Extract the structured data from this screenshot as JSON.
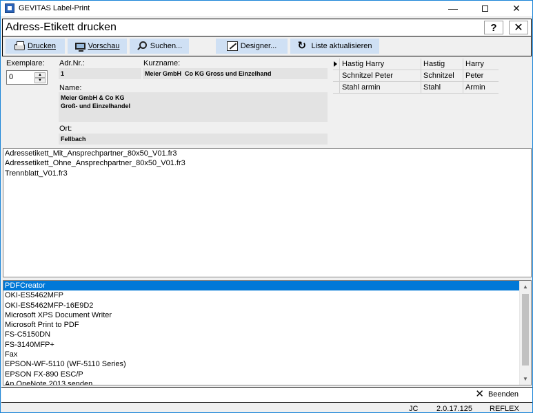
{
  "window": {
    "title": "GEVITAS Label-Print",
    "minimize": "—",
    "close": "✕"
  },
  "header": {
    "title": "Adress-Etikett drucken",
    "help": "?",
    "close": "✕"
  },
  "toolbar": {
    "print_label": "Drucken",
    "preview_label": "Vorschau",
    "search_label": "Suchen...",
    "designer_label": "Designer...",
    "refresh_label": "Liste aktualisieren",
    "button_color": "#cfe0f4"
  },
  "form": {
    "copies_label": "Exemplare:",
    "copies_value": "0",
    "addr_nr_label": "Adr.Nr.:",
    "addr_nr_value": "1",
    "short_name_label": "Kurzname:",
    "short_name_value": "Meier GmbH  Co KG Gross und Einzelhand",
    "name_label": "Name:",
    "name_value": "Meier GmbH & Co KG\nGroß- und Einzelhandel",
    "city_label": "Ort:",
    "city_value": "Fellbach"
  },
  "contacts": {
    "rows": [
      {
        "full": "Hastig Harry",
        "last": "Hastig",
        "first": "Harry"
      },
      {
        "full": "Schnitzel Peter",
        "last": "Schnitzel",
        "first": "Peter"
      },
      {
        "full": "Stahl armin",
        "last": "Stahl",
        "first": "Armin"
      }
    ]
  },
  "templates": {
    "items": [
      "Adressetikett_Mit_Ansprechpartner_80x50_V01.fr3",
      "Adressetikett_Ohne_Ansprechpartner_80x50_V01.fr3",
      "Trennblatt_V01.fr3"
    ]
  },
  "printers": {
    "items": [
      "PDFCreator",
      "OKI-ES5462MFP",
      "OKI-ES5462MFP-16E9D2",
      "Microsoft XPS Document Writer",
      "Microsoft Print to PDF",
      "FS-C5150DN",
      "FS-3140MFP+",
      "Fax",
      "EPSON-WF-5110 (WF-5110 Series)",
      "EPSON FX-890 ESC/P",
      "An OneNote 2013 senden"
    ],
    "selected_color": "#0078d7"
  },
  "footer": {
    "quit_label": "Beenden"
  },
  "statusbar": {
    "user": "JC",
    "version": "2.0.17.125",
    "mode": "REFLEX"
  }
}
